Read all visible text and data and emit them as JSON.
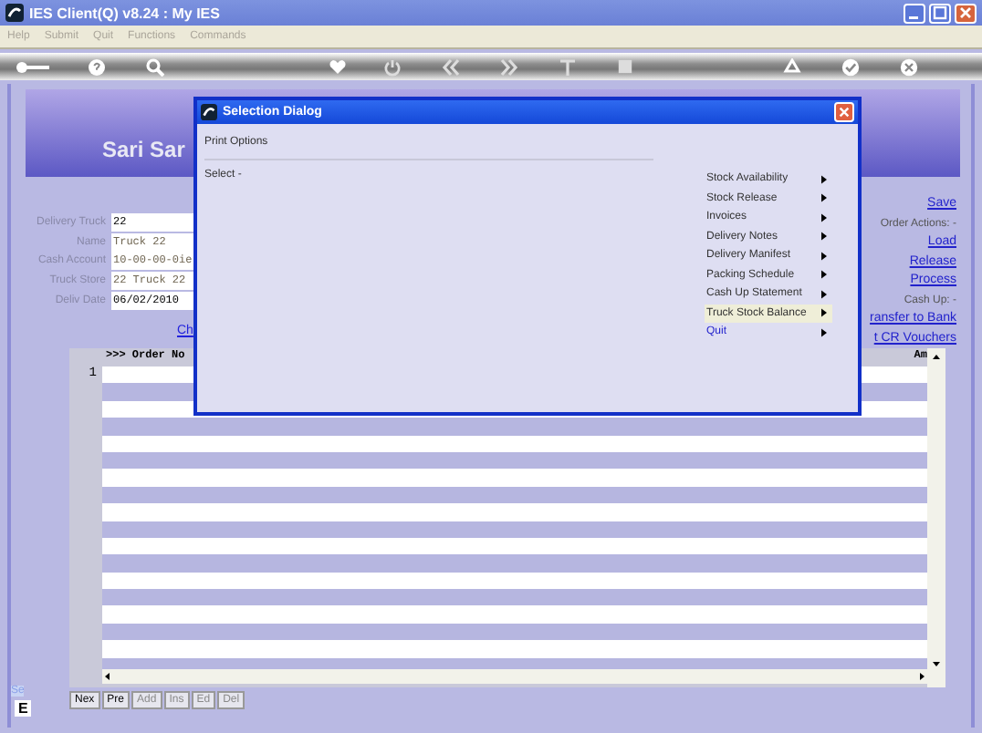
{
  "window": {
    "title": "IES Client(Q) v8.24 : My IES"
  },
  "menu": [
    "Help",
    "Submit",
    "Quit",
    "Functions",
    "Commands"
  ],
  "banner": {
    "title": "Sari Sar"
  },
  "form": [
    {
      "label": "Delivery Truck",
      "value": "22",
      "disabled": false
    },
    {
      "label": "Name",
      "value": "Truck 22",
      "disabled": true
    },
    {
      "label": "Cash Account",
      "value": "10-00-00-0ie",
      "disabled": true
    },
    {
      "label": "Truck Store",
      "value": "22 Truck 22",
      "disabled": true
    },
    {
      "label": "Deliv Date",
      "value": "06/02/2010",
      "disabled": false
    }
  ],
  "form_link": "Ch",
  "actions": [
    {
      "kind": "link",
      "text": "Save"
    },
    {
      "kind": "label",
      "text": "Order Actions: -"
    },
    {
      "kind": "link",
      "text": "Load"
    },
    {
      "kind": "link",
      "text": "Release"
    },
    {
      "kind": "link",
      "text": "Process"
    },
    {
      "kind": "label",
      "text": "Cash Up: -"
    },
    {
      "kind": "link",
      "text": "ransfer to Bank"
    },
    {
      "kind": "link",
      "text": "t CR Vouchers"
    }
  ],
  "side_tabs": [
    "Se",
    "E"
  ],
  "grid": {
    "column_1": ">>> Order No",
    "column_2": "Am",
    "row_numbers": [
      "1"
    ]
  },
  "grid_buttons": [
    {
      "label": "Nex",
      "disabled": false
    },
    {
      "label": "Pre",
      "disabled": false
    },
    {
      "label": "Add",
      "disabled": true
    },
    {
      "label": "Ins",
      "disabled": true
    },
    {
      "label": "Ed",
      "disabled": true
    },
    {
      "label": "Del",
      "disabled": true
    }
  ],
  "dialog": {
    "title": "Selection Dialog",
    "heading": "Print Options",
    "prompt": "Select -",
    "options": [
      {
        "label": "Stock Availability",
        "kind": "submenu",
        "selected": false
      },
      {
        "label": "Stock Release",
        "kind": "submenu",
        "selected": false
      },
      {
        "label": "Invoices",
        "kind": "submenu",
        "selected": false
      },
      {
        "label": "Delivery Notes",
        "kind": "submenu",
        "selected": false
      },
      {
        "label": "Delivery Manifest",
        "kind": "submenu",
        "selected": false
      },
      {
        "label": "Packing Schedule",
        "kind": "submenu",
        "selected": false
      },
      {
        "label": "Cash Up Statement",
        "kind": "submenu",
        "selected": false
      },
      {
        "label": "Truck Stock Balance",
        "kind": "submenu",
        "selected": true
      },
      {
        "label": "Quit",
        "kind": "command",
        "selected": false
      }
    ]
  }
}
